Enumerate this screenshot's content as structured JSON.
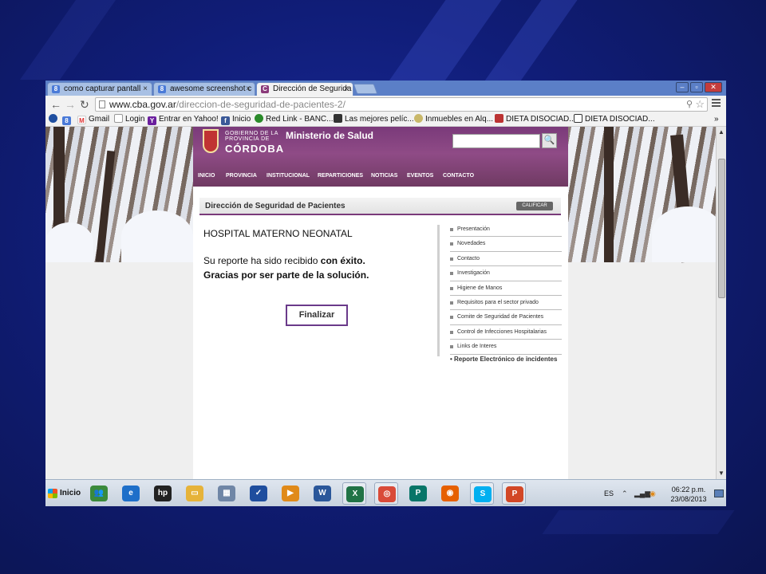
{
  "browser": {
    "tabs": [
      {
        "label": "como capturar pantall",
        "icon": "google-plus-icon"
      },
      {
        "label": "awesome screenshot c",
        "icon": "google-plus-icon"
      },
      {
        "label": "Dirección de Segurida",
        "icon": "cordoba-icon"
      }
    ],
    "url_host": "www.cba.gov.ar",
    "url_path": "/direccion-de-seguridad-de-pacientes-2/",
    "bookmarks": [
      {
        "label": ""
      },
      {
        "label": ""
      },
      {
        "label": "Gmail"
      },
      {
        "label": "Login"
      },
      {
        "label": "Entrar en Yahoo!"
      },
      {
        "label": "Inicio"
      },
      {
        "label": "Red Link - BANC..."
      },
      {
        "label": "Las mejores pelíc..."
      },
      {
        "label": "Inmuebles en Alq..."
      },
      {
        "label": "DIETA DISOCIAD..."
      },
      {
        "label": "DIETA DISOCIAD..."
      }
    ],
    "bookmarks_more": "»"
  },
  "site": {
    "logo_line1": "GOBIERNO DE LA",
    "logo_line2": "PROVINCIA DE",
    "logo_line3": "CÓRDOBA",
    "ministry": "Ministerio de Salud",
    "search_button": "🔍",
    "nav": [
      "INICIO",
      "PROVINCIA",
      "INSTITUCIONAL",
      "REPARTICIONES",
      "NOTICIAS",
      "EVENTOS",
      "CONTACTO"
    ]
  },
  "panel": {
    "title": "Dirección de Seguridad de Pacientes",
    "calificar": "CALIFICAR",
    "hospital": "HOSPITAL MATERNO NEONATAL",
    "message_part1": "Su reporte ha sido recibido",
    "message_part2": "con éxito.",
    "message_line2": "Gracias por ser parte de la solución.",
    "finalizar": "Finalizar",
    "side_menu": [
      "Presentación",
      "Novedades",
      "Contacto",
      "Investigación",
      "Higiene de Manos",
      "Requisitos para el sector privado",
      "Comite de Seguridad de Pacientes",
      "Control de Infecciones Hospitalarias",
      "Links de Interes"
    ],
    "reporte_link": "• Reporte Electrónico de incidentes"
  },
  "taskbar": {
    "start": "Inicio",
    "language": "ES",
    "time": "06:22 p.m.",
    "date": "23/08/2013",
    "apps": [
      {
        "name": "people-icon",
        "color": "#3b8a3b"
      },
      {
        "name": "internet-explorer-icon",
        "color": "#1e6fc9"
      },
      {
        "name": "hp-icon",
        "color": "#222222"
      },
      {
        "name": "folder-icon",
        "color": "#e6b33a"
      },
      {
        "name": "calculator-icon",
        "color": "#6f86a6"
      },
      {
        "name": "checkmark-icon",
        "color": "#1f4e9e"
      },
      {
        "name": "media-player-icon",
        "color": "#e08a1a"
      },
      {
        "name": "word-icon",
        "color": "#2b579a"
      },
      {
        "name": "excel-icon",
        "color": "#217346"
      },
      {
        "name": "chrome-icon",
        "color": "#d94a38"
      },
      {
        "name": "publisher-icon",
        "color": "#077568"
      },
      {
        "name": "firefox-icon",
        "color": "#e66000"
      },
      {
        "name": "skype-icon",
        "color": "#00aff0"
      },
      {
        "name": "powerpoint-icon",
        "color": "#d24726"
      }
    ]
  },
  "colors": {
    "header_purple": "#7a3a7a",
    "button_border": "#6a3a8a",
    "desktop_blue": "#101d78"
  }
}
